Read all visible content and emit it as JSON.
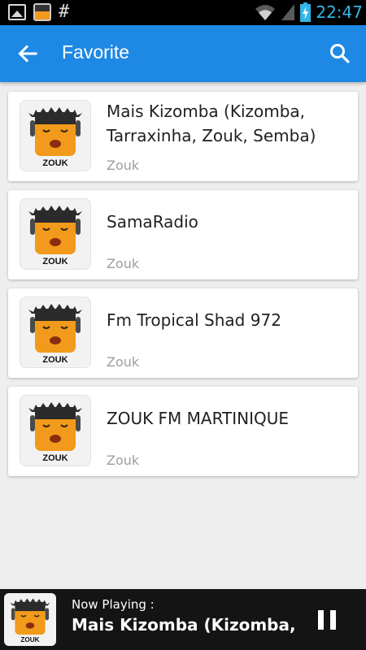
{
  "status_bar": {
    "time": "22:47",
    "left_icons": [
      "gallery-icon",
      "app-notification-icon",
      "hash-icon"
    ],
    "hash_glyph": "#",
    "right_icons": [
      "wifi-icon",
      "signal-icon",
      "battery-charging-icon"
    ],
    "time_color": "#33b5e5"
  },
  "app_bar": {
    "title": "Favorite",
    "back_icon": "arrow-left-icon",
    "search_icon": "search-icon",
    "color": "#1e88e5"
  },
  "stations": [
    {
      "name": "Mais Kizomba (Kizomba, Tarraxinha, Zouk, Semba)",
      "genre": "Zouk",
      "logo_text": "ZOUK"
    },
    {
      "name": "SamaRadio",
      "genre": "Zouk",
      "logo_text": "ZOUK"
    },
    {
      "name": "Fm Tropical Shad 972",
      "genre": "Zouk",
      "logo_text": "ZOUK"
    },
    {
      "name": "ZOUK FM MARTINIQUE",
      "genre": "Zouk",
      "logo_text": "ZOUK"
    }
  ],
  "player": {
    "label": "Now Playing :",
    "title": "Mais Kizomba (Kizomba,",
    "logo_text": "ZOUK",
    "control_icon": "pause-icon"
  }
}
